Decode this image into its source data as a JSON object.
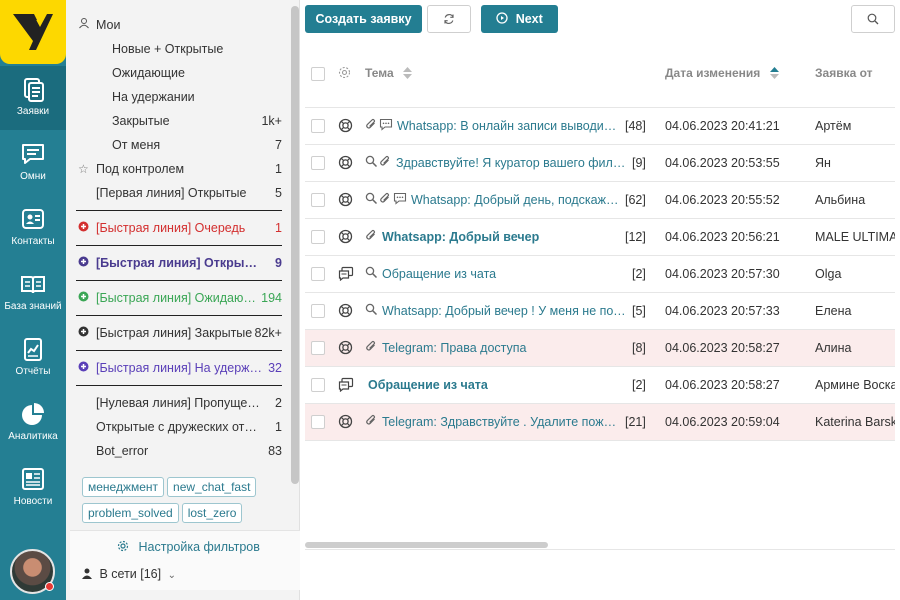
{
  "nav": {
    "items": [
      {
        "label": "Заявки",
        "icon": "tickets-icon"
      },
      {
        "label": "Омни",
        "icon": "chat-icon"
      },
      {
        "label": "Контакты",
        "icon": "contacts-icon"
      },
      {
        "label": "База знаний",
        "icon": "book-icon"
      },
      {
        "label": "Отчёты",
        "icon": "report-icon"
      },
      {
        "label": "Аналитика",
        "icon": "pie-chart-icon"
      },
      {
        "label": "Новости",
        "icon": "news-icon"
      }
    ]
  },
  "filters": {
    "mine": "Мои",
    "items": [
      {
        "label": "Новые + Открытые",
        "count": ""
      },
      {
        "label": "Ожидающие",
        "count": ""
      },
      {
        "label": "На удержании",
        "count": ""
      },
      {
        "label": "Закрытые",
        "count": "1k+"
      },
      {
        "label": "От меня",
        "count": "7"
      }
    ],
    "watched": {
      "label": "Под контролем",
      "count": "1"
    },
    "first_line": {
      "label": "[Первая линия] Открытые",
      "count": "5"
    },
    "fast": [
      {
        "label": "[Быстрая линия] Очередь",
        "count": "1",
        "color": "#d32f2f"
      },
      {
        "label": "[Быстрая линия] Открыт…",
        "count": "9",
        "color": "#4a3b8f"
      },
      {
        "label": "[Быстрая линия] Ожидаю…",
        "count": "194",
        "color": "#3aa655"
      },
      {
        "label": "[Быстрая линия] Закрытые",
        "count": "82k+",
        "color": "#333333"
      },
      {
        "label": "[Быстрая линия] На удерж…",
        "count": "32",
        "color": "#5a3fb8"
      }
    ],
    "other": [
      {
        "label": "[Нулевая линия] Пропуще…",
        "count": "2"
      },
      {
        "label": "Открытые с дружеских от…",
        "count": "1"
      },
      {
        "label": "Bot_error",
        "count": "83"
      }
    ],
    "tags": [
      "менеджмент",
      "new_chat_fast",
      "problem_solved",
      "lost_zero"
    ],
    "settings_label": "Настройка фильтров",
    "online_label": "В сети [16]"
  },
  "toolbar": {
    "create_label": "Создать заявку",
    "next_label": "Next"
  },
  "table": {
    "headers": {
      "subject": "Тема",
      "date": "Дата изменения",
      "from": "Заявка от"
    },
    "rows": [
      {
        "subject": "Whatsapp: В онлайн записи выводитс…",
        "count": "[48]",
        "date": "04.06.2023 20:41:21",
        "from": "Артём",
        "bold": false,
        "pink": false,
        "type": "lifebuoy",
        "icons": [
          "clip",
          "comment"
        ]
      },
      {
        "subject": "Здравствуйте! Я куратор вашего фили…",
        "count": "[9]",
        "date": "04.06.2023 20:53:55",
        "from": "Ян",
        "bold": false,
        "pink": false,
        "type": "lifebuoy",
        "icons": [
          "search",
          "clip"
        ]
      },
      {
        "subject": "Whatsapp: Добрый день, подскажи…",
        "count": "[62]",
        "date": "04.06.2023 20:55:52",
        "from": "Альбина",
        "bold": false,
        "pink": false,
        "type": "lifebuoy",
        "icons": [
          "search",
          "clip",
          "comment"
        ]
      },
      {
        "subject": "Whatsapp: Добрый вечер",
        "count": "[12]",
        "date": "04.06.2023 20:56:21",
        "from": "MALE ULTIMATE",
        "bold": true,
        "pink": false,
        "type": "lifebuoy",
        "icons": [
          "clip"
        ]
      },
      {
        "subject": "Обращение из чата",
        "count": "[2]",
        "date": "04.06.2023 20:57:30",
        "from": "Olga",
        "bold": false,
        "pink": false,
        "type": "chat",
        "icons": [
          "search"
        ]
      },
      {
        "subject": "Whatsapp: Добрый вечер ! У меня не пол…",
        "count": "[5]",
        "date": "04.06.2023 20:57:33",
        "from": "Елена",
        "bold": false,
        "pink": false,
        "type": "lifebuoy",
        "icons": [
          "search"
        ]
      },
      {
        "subject": "Telegram: Права доступа",
        "count": "[8]",
        "date": "04.06.2023 20:58:27",
        "from": "Алина",
        "bold": false,
        "pink": true,
        "type": "lifebuoy",
        "icons": [
          "clip"
        ]
      },
      {
        "subject": "Обращение из чата",
        "count": "[2]",
        "date": "04.06.2023 20:58:27",
        "from": "Армине Воскан",
        "bold": true,
        "pink": false,
        "type": "chat",
        "icons": []
      },
      {
        "subject": "Telegram: Здравствуйте . Удалите пожа…",
        "count": "[21]",
        "date": "04.06.2023 20:59:04",
        "from": "Katerina Barskaya",
        "bold": false,
        "pink": true,
        "type": "lifebuoy",
        "icons": [
          "clip"
        ]
      }
    ]
  }
}
